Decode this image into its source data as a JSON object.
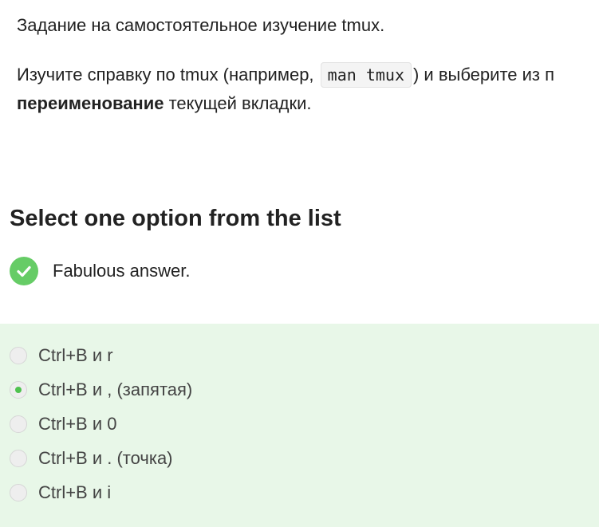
{
  "task": {
    "line1": "Задание на самостоятельное изучение tmux.",
    "line2_before": "Изучите справку по tmux (например, ",
    "line2_code": "man tmux",
    "line2_after": ") и выберите из п",
    "line3_bold": "переименование",
    "line3_rest": " текущей вкладки."
  },
  "quiz": {
    "prompt": "Select one option from the list",
    "feedback": "Fabulous answer.",
    "options": [
      {
        "label": "Ctrl+B и r",
        "selected": false
      },
      {
        "label": "Ctrl+B и , (запятая)",
        "selected": true
      },
      {
        "label": "Ctrl+B и 0",
        "selected": false
      },
      {
        "label": "Ctrl+B и . (точка)",
        "selected": false
      },
      {
        "label": "Ctrl+B и i",
        "selected": false
      }
    ]
  },
  "colors": {
    "success_green": "#66cc66",
    "options_background": "#e8f7e8",
    "radio_selected": "#4fc24f"
  },
  "icons": {
    "feedback": "check-circle-icon"
  }
}
